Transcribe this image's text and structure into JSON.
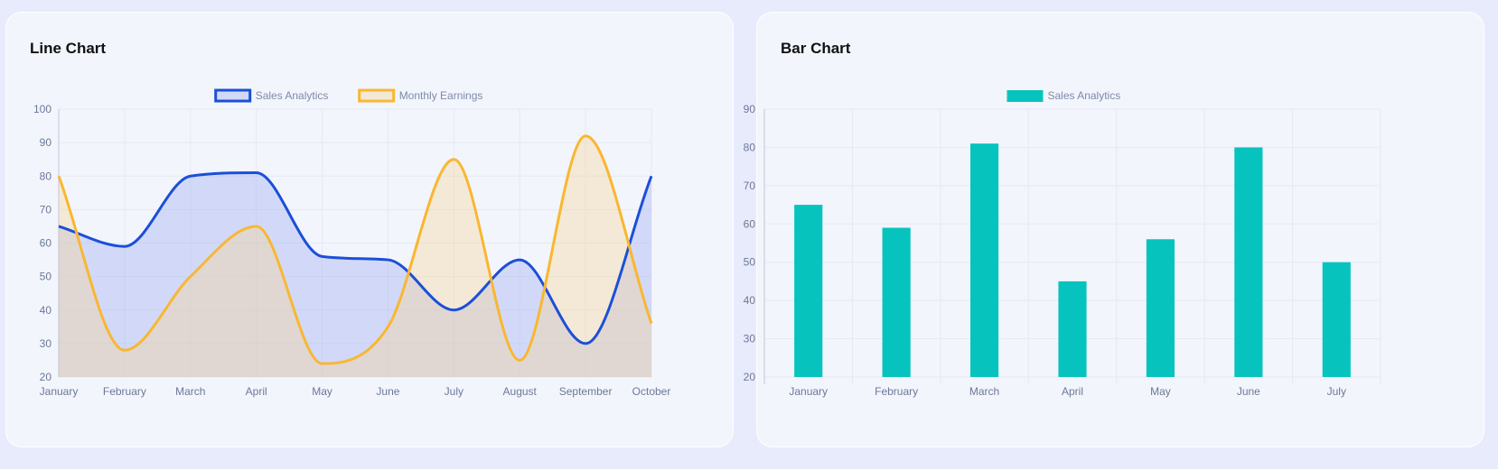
{
  "colors": {
    "sales_line": "#1b4fd8",
    "sales_fill": "rgba(140,160,240,0.32)",
    "earnings_line": "#f9b731",
    "earnings_fill": "rgba(248,214,150,0.38)",
    "bar": "#06c4bd",
    "grid": "#e6e9f3",
    "axis": "#bfc6d6"
  },
  "line_card": {
    "title": "Line Chart"
  },
  "bar_card": {
    "title": "Bar Chart"
  },
  "chart_data": [
    {
      "type": "line",
      "title": "Line Chart",
      "categories": [
        "January",
        "February",
        "March",
        "April",
        "May",
        "June",
        "July",
        "August",
        "September",
        "October"
      ],
      "ylim": [
        20,
        100
      ],
      "yticks": [
        20,
        30,
        40,
        50,
        60,
        70,
        80,
        90,
        100
      ],
      "grid": true,
      "legend_position": "top-center",
      "series": [
        {
          "name": "Sales Analytics",
          "values": [
            65,
            59,
            80,
            81,
            56,
            55,
            40,
            55,
            30,
            80
          ],
          "smooth": true,
          "filled": true
        },
        {
          "name": "Monthly Earnings",
          "values": [
            80,
            28,
            50,
            65,
            24,
            35,
            85,
            25,
            92,
            36
          ],
          "smooth": true,
          "filled": true
        }
      ]
    },
    {
      "type": "bar",
      "title": "Bar Chart",
      "categories": [
        "January",
        "February",
        "March",
        "April",
        "May",
        "June",
        "July"
      ],
      "ylim": [
        20,
        90
      ],
      "yticks": [
        20,
        30,
        40,
        50,
        60,
        70,
        80,
        90
      ],
      "grid": true,
      "legend_position": "top-center",
      "series": [
        {
          "name": "Sales Analytics",
          "values": [
            65,
            59,
            81,
            45,
            56,
            80,
            50
          ]
        }
      ]
    }
  ]
}
